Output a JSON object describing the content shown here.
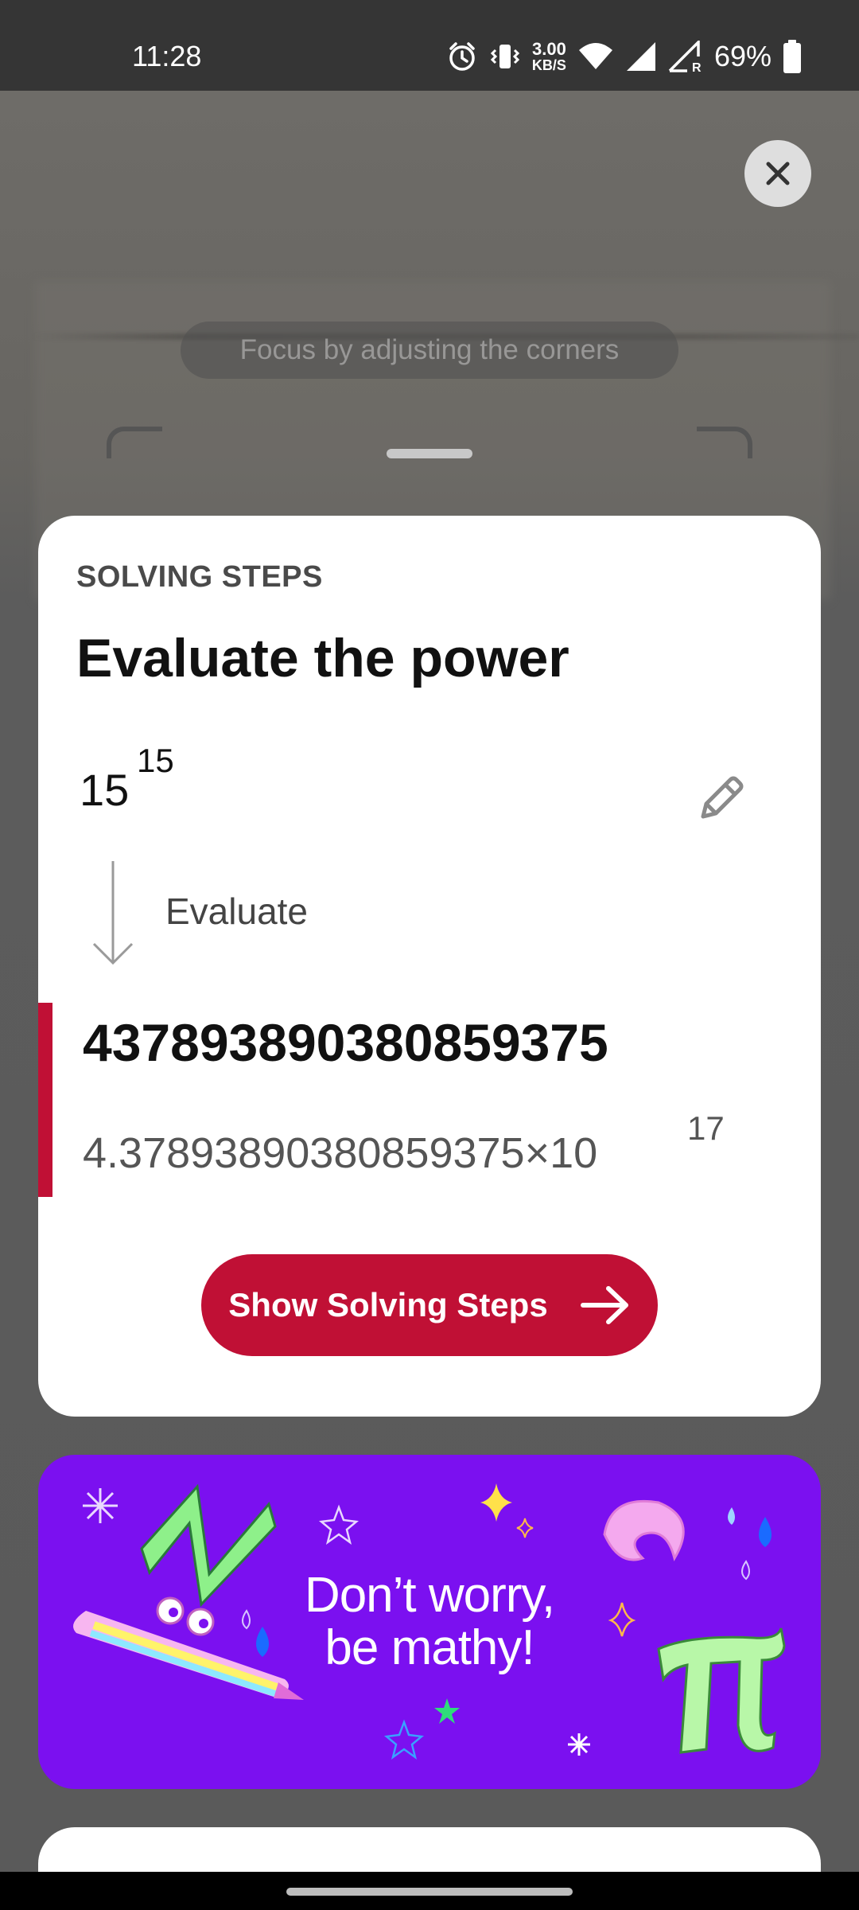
{
  "status_bar": {
    "time": "11:28",
    "speed_value": "3.00",
    "speed_unit": "KB/S",
    "battery_percent": "69%",
    "icons": [
      "alarm-icon",
      "vibrate-icon",
      "wifi-icon",
      "signal-icon",
      "signal-roaming-icon",
      "battery-icon"
    ]
  },
  "camera": {
    "focus_hint": "Focus by adjusting the corners",
    "close_icon": "close-icon"
  },
  "card": {
    "eyebrow": "SOLVING STEPS",
    "title": "Evaluate the power",
    "expression": {
      "base": "15",
      "exponent": "15"
    },
    "edit_icon": "pencil-icon",
    "step_label": "Evaluate",
    "result": "437893890380859375",
    "scientific": {
      "mantissa": "4.37893890380859375",
      "times": "×",
      "base": "10",
      "exponent": "17"
    },
    "button_label": "Show Solving Steps",
    "button_icon": "arrow-right-icon"
  },
  "promo": {
    "line1": "Don’t worry,",
    "line2": "be mathy!"
  },
  "colors": {
    "accent": "#c01035",
    "promo_bg": "#7b10f0",
    "status_bar_bg": "#353535"
  }
}
